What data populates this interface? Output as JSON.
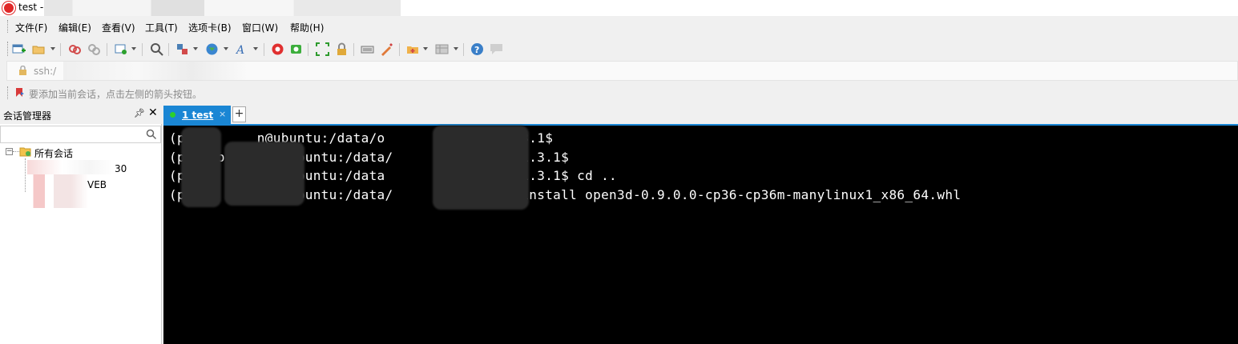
{
  "window": {
    "title": "test -"
  },
  "menu": [
    {
      "label": "文件(F)"
    },
    {
      "label": "编辑(E)"
    },
    {
      "label": "查看(V)"
    },
    {
      "label": "工具(T)"
    },
    {
      "label": "选项卡(B)"
    },
    {
      "label": "窗口(W)"
    },
    {
      "label": "帮助(H)"
    }
  ],
  "toolbar": {
    "icons": [
      "new-session-icon",
      "open-folder-icon",
      "reconnect-icon",
      "disconnect-icon",
      "properties-icon",
      "find-icon",
      "transfer-icon",
      "globe-icon",
      "font-icon",
      "xftp-icon",
      "xshell-green-icon",
      "fullscreen-icon",
      "lock-icon",
      "keyboard-icon",
      "compose-icon",
      "new-tab-icon",
      "layout-icon",
      "help-icon",
      "chat-icon"
    ]
  },
  "address": {
    "value": "ssh:/"
  },
  "hint": {
    "text": "要添加当前会话，点击左侧的箭头按钮。"
  },
  "session_manager": {
    "title": "会话管理器",
    "pin": "ꟷ",
    "close": "✕",
    "search_placeholder": "",
    "root": "所有会话",
    "items": [
      {
        "label": "30"
      },
      {
        "label": "VEB"
      }
    ]
  },
  "tabs": [
    {
      "label": "1 test",
      "close": "×",
      "status_color": "#2cd02c"
    }
  ],
  "new_tab": "+",
  "terminal": {
    "lines": [
      "(p         n@ubuntu:/data/o         /pip-21.3.1$",
      "(p 6) ouc    n@ubuntu:/data/          /pip-21.3.1$",
      "(p 6)        n@ubuntu:/data        c  /pip-21.3.1$ cd ..",
      "(p 6)        n@ubuntu:/data/          $ pip install open3d-0.9.0.0-cp36-cp36m-manylinux1_x86_64.whl"
    ]
  },
  "colors": {
    "accent": "#1a86d4",
    "terminal_bg": "#000000",
    "terminal_fg": "#ffffff"
  }
}
